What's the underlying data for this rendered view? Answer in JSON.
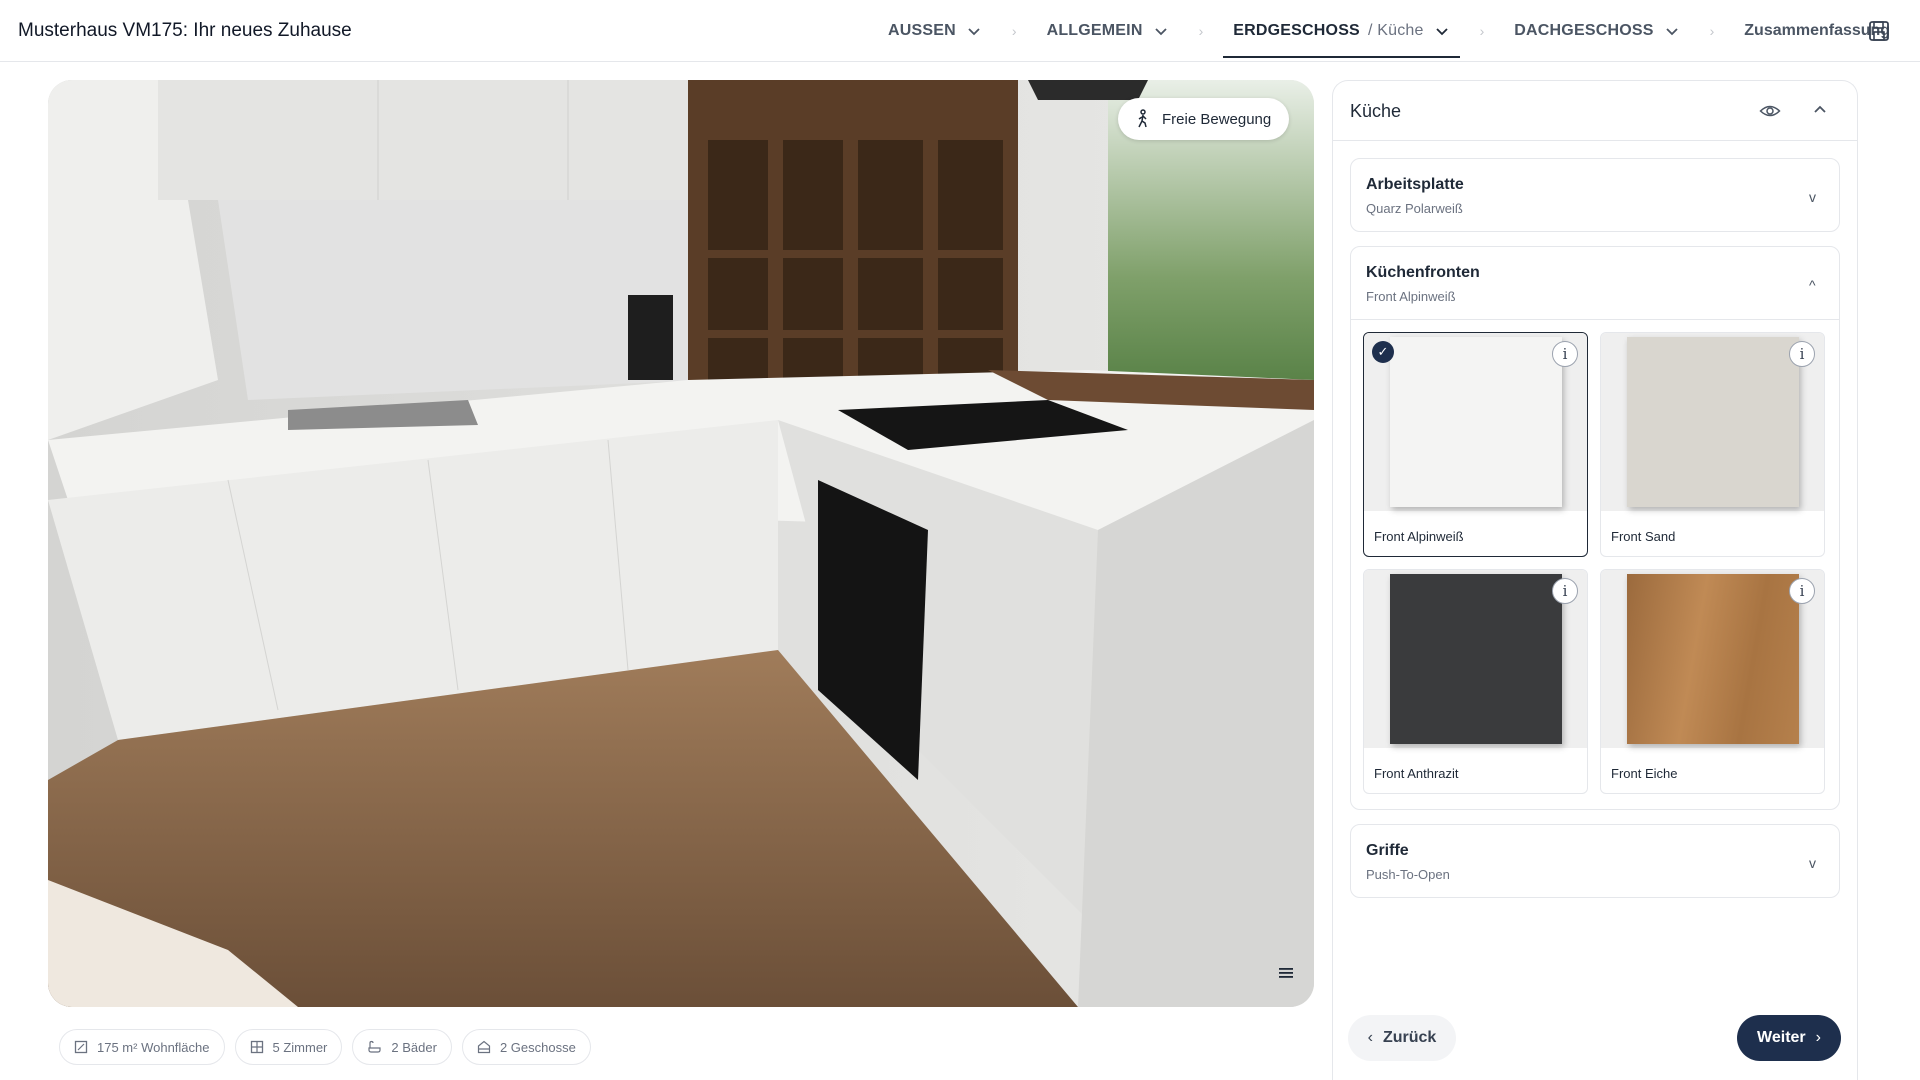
{
  "header": {
    "title": "Musterhaus VM175: Ihr neues Zuhause",
    "nav": [
      {
        "label": "AUSSEN"
      },
      {
        "label": "ALLGEMEIN"
      },
      {
        "label": "ERDGESCHOSS",
        "sub": "/ Küche",
        "active": true
      },
      {
        "label": "DACHGESCHOSS"
      }
    ],
    "summary": "Zusammenfassung",
    "separator": "›"
  },
  "viewer": {
    "free_move_label": "Freie Bewegung"
  },
  "stats": [
    {
      "icon": "area-icon",
      "label": "175 m² Wohnfläche"
    },
    {
      "icon": "rooms-icon",
      "label": "5 Zimmer"
    },
    {
      "icon": "bath-icon",
      "label": "2 Bäder"
    },
    {
      "icon": "floors-icon",
      "label": "2 Geschosse"
    }
  ],
  "panel": {
    "title": "Küche",
    "sections": [
      {
        "name": "Arbeitsplatte",
        "value": "Quarz Polarweiß",
        "expanded": false,
        "chevron": "v"
      },
      {
        "name": "Küchenfronten",
        "value": "Front Alpinweiß",
        "expanded": true,
        "chevron": "^"
      },
      {
        "name": "Griffe",
        "value": "Push-To-Open",
        "expanded": false,
        "chevron": "v"
      }
    ],
    "options": [
      {
        "label": "Front Alpinweiß",
        "color": "#f4f4f3",
        "selected": true
      },
      {
        "label": "Front Sand",
        "color": "#d9d6cf",
        "selected": false
      },
      {
        "label": "Front Anthrazit",
        "color": "#3a3b3d",
        "selected": false
      },
      {
        "label": "Front Eiche",
        "color": "#b07a45",
        "selected": false
      }
    ],
    "info_glyph": "i",
    "check_glyph": "✓"
  },
  "footer": {
    "back_label": "Zurück",
    "next_label": "Weiter"
  },
  "colors": {
    "primary": "#1e2f4d",
    "border": "#e5e7eb"
  }
}
